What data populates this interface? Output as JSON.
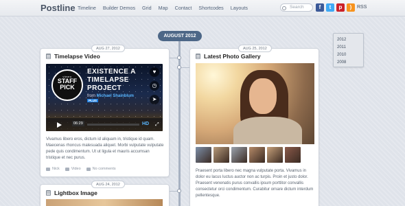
{
  "header": {
    "logo": "Postline",
    "nav": [
      "Timeline",
      "Builder Demos",
      "Grid",
      "Map",
      "Contact",
      "Shortcodes",
      "Layouts"
    ],
    "search_placeholder": "Search",
    "social": [
      {
        "name": "facebook-icon",
        "glyph": "f",
        "color": "#3b5998"
      },
      {
        "name": "twitter-icon",
        "glyph": "t",
        "color": "#3fa9f5"
      },
      {
        "name": "pinterest-icon",
        "glyph": "p",
        "color": "#cb2027"
      },
      {
        "name": "rss-icon",
        "glyph": ")",
        "color": "#f7931e"
      }
    ],
    "rss_label": "RSS"
  },
  "timeline": {
    "month_label": "AUGUST 2012"
  },
  "archive": {
    "years": [
      "2012",
      "2011",
      "2010",
      "2008"
    ]
  },
  "posts": {
    "video": {
      "date": "AUG 27, 2012",
      "title": "Timelapse Video",
      "player": {
        "badge_top": "vimeo",
        "badge_line1": "STAFF",
        "badge_line2": "PICK",
        "video_title": "EXISTENCE A TIMELAPSE PROJECT",
        "from_prefix": "from",
        "author": "Michael Shainblum",
        "plus_badge": "PLUS",
        "time": "06:29",
        "progress": 0.0,
        "hd_label": "HD"
      },
      "excerpt": "Vivamus libero eros, dictum id aliquam in, tristique id quam. Maecenas rhoncus malesuada aliquet. Morbi vulputate vulputate pede quis condimentum. Ut ut ligula et mauris accumsan tristique et nec purus.",
      "meta": {
        "author": "Nick",
        "category": "Video",
        "comments": "No comments"
      }
    },
    "gallery": {
      "date": "AUG 25, 2012",
      "title": "Latest Photo Gallery",
      "thumb_colors": [
        "#7d8fa8",
        "#b79a7a",
        "#9aa3ad",
        "#b48a68",
        "#c6a07a",
        "#8a5a4a"
      ],
      "excerpt": "Praesent porta libero nec magna vulputate porta. Vivamus in dolor eu lacus luctus auctor non ac turpis. Proin et justo dolor. Praesent venenatis purus convallis ipsum porttitor convallis consectetur orci condimentum. Curabitur ornare dictum interdum pellentesque."
    },
    "lightbox": {
      "date": "AUG 24, 2012",
      "title": "Lightbox Image"
    }
  }
}
